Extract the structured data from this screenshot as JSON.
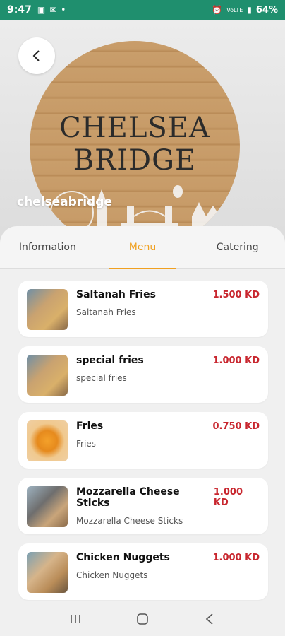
{
  "status_bar": {
    "time": "9:47",
    "battery": "64%",
    "network": "VoLTE",
    "accent": "#1f8f6e"
  },
  "hero": {
    "logo_text": "CHELSEA BRIDGE",
    "brand_name": "chelseabridge"
  },
  "tabs": [
    {
      "label": "Information",
      "active": false
    },
    {
      "label": "Menu",
      "active": true
    },
    {
      "label": "Catering",
      "active": false
    }
  ],
  "menu_items": [
    {
      "name": "Saltanah Fries",
      "desc": "Saltanah Fries",
      "price": "1.500 KD",
      "thumb": "fries-basket"
    },
    {
      "name": "special fries",
      "desc": "special fries",
      "price": "1.000 KD",
      "thumb": "fries-basket"
    },
    {
      "name": "Fries",
      "desc": "Fries",
      "price": "0.750 KD",
      "thumb": "fries-plain"
    },
    {
      "name": "Mozzarella Cheese Sticks",
      "desc": "Mozzarella Cheese Sticks",
      "price": "1.000 KD",
      "thumb": "sticks"
    },
    {
      "name": "Chicken Nuggets",
      "desc": "Chicken Nuggets",
      "price": "1.000 KD",
      "thumb": "nuggets"
    }
  ],
  "colors": {
    "active_tab": "#f0a020",
    "price": "#c8262e"
  }
}
